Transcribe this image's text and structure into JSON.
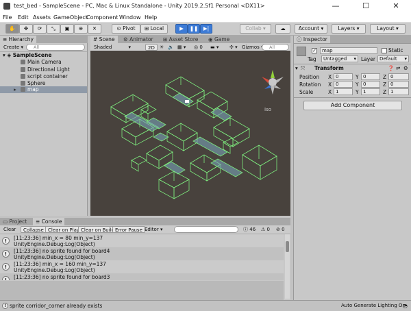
{
  "window": {
    "title": "test_bed - SampleScene - PC, Mac & Linux Standalone - Unity 2019.2.5f1 Personal <DX11>",
    "minimize": "—",
    "maximize": "☐",
    "close": "✕"
  },
  "menu": [
    "File",
    "Edit",
    "Assets",
    "GameObject",
    "Component",
    "Window",
    "Help"
  ],
  "toolbar": {
    "pivot": "Pivot",
    "local": "Local",
    "collab": "Collab",
    "account": "Account",
    "layers": "Layers",
    "layout": "Layout"
  },
  "hierarchy": {
    "tab": "Hierarchy",
    "create": "Create",
    "search_placeholder": "All",
    "scene": "SampleScene",
    "items": [
      "Main Camera",
      "Directional Light",
      "script container",
      "Sphere",
      "map"
    ]
  },
  "scene": {
    "tabs": [
      "Scene",
      "Animator",
      "Asset Store",
      "Game"
    ],
    "shading": "Shaded",
    "mode2d": "2D",
    "gizmos": "Gizmos",
    "search_placeholder": "All",
    "iso": "Iso"
  },
  "inspector": {
    "tab": "Inspector",
    "object_name": "map",
    "static": "Static",
    "tag_label": "Tag",
    "tag_value": "Untagged",
    "layer_label": "Layer",
    "layer_value": "Default",
    "component": "Transform",
    "position_label": "Position",
    "rotation_label": "Rotation",
    "scale_label": "Scale",
    "position": [
      "0",
      "0",
      "0"
    ],
    "rotation": [
      "0",
      "0",
      "0"
    ],
    "scale": [
      "1",
      "1",
      "1"
    ],
    "axes": [
      "X",
      "Y",
      "Z"
    ],
    "add_component": "Add Component"
  },
  "console": {
    "tabs": [
      "Project",
      "Console"
    ],
    "buttons": [
      "Clear",
      "Collapse",
      "Clear on Play",
      "Clear on Build",
      "Error Pause",
      "Editor"
    ],
    "counts": [
      "46",
      "0",
      "0"
    ],
    "logs": [
      {
        "l1": "[11:23:36] min_x = 80 min_y=137",
        "l2": "UnityEngine.Debug:Log(Object)"
      },
      {
        "l1": "[11:23:36] no sprite found for board4",
        "l2": "UnityEngine.Debug:Log(Object)"
      },
      {
        "l1": "[11:23:36] min_x = 160 min_y=137",
        "l2": "UnityEngine.Debug:Log(Object)"
      },
      {
        "l1": "[11:23:36] no sprite found for board3",
        "l2": ""
      }
    ]
  },
  "status": {
    "message": "sprite corridor_corner already exists",
    "lighting": "Auto Generate Lighting On"
  },
  "colors": {
    "accent": "#3d7bd6",
    "viewport_bg": "#48423d",
    "wire": "#7dea7d"
  }
}
